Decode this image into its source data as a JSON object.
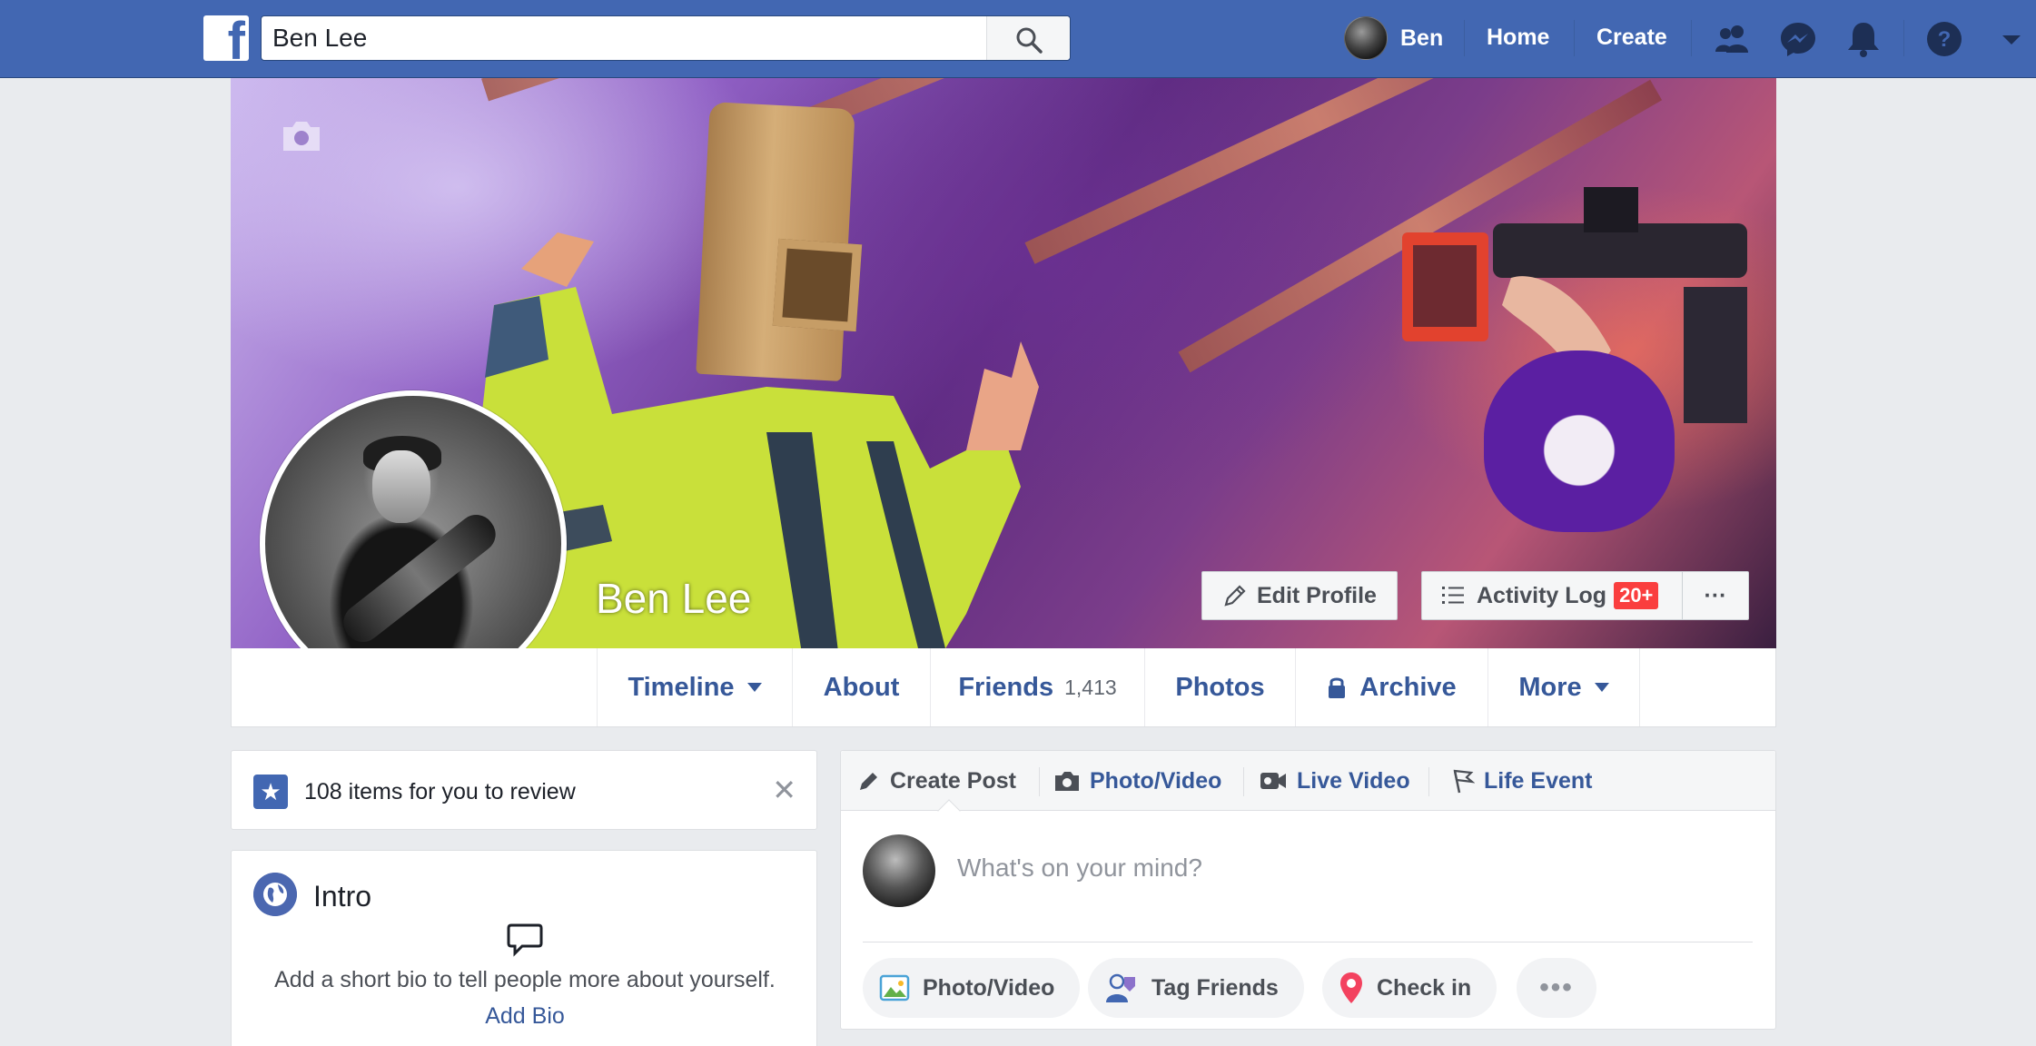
{
  "topbar": {
    "logo_letter": "f",
    "search_value": "Ben Lee",
    "user_name": "Ben",
    "home_label": "Home",
    "create_label": "Create",
    "icons": [
      "friend-requests-icon",
      "messenger-icon",
      "notifications-icon",
      "help-icon",
      "account-menu-icon"
    ]
  },
  "profile": {
    "name": "Ben Lee",
    "edit_label": "Edit Profile",
    "activity_label": "Activity Log",
    "activity_badge": "20+",
    "more_dots": "···"
  },
  "tabs": {
    "timeline": "Timeline",
    "about": "About",
    "friends": "Friends",
    "friends_count": "1,413",
    "photos": "Photos",
    "archive": "Archive",
    "more": "More"
  },
  "review": {
    "text": "108 items for you to review",
    "close": "✕"
  },
  "intro": {
    "title": "Intro",
    "description": "Add a short bio to tell people more about yourself.",
    "add_bio": "Add Bio"
  },
  "composer": {
    "create_post": "Create Post",
    "photo_video": "Photo/Video",
    "live_video": "Live Video",
    "life_event": "Life Event",
    "placeholder": "What's on your mind?",
    "pill_photo_video": "Photo/Video",
    "pill_tag_friends": "Tag Friends",
    "pill_check_in": "Check in",
    "pill_more": "•••"
  },
  "colors": {
    "brand_blue": "#4267b2",
    "link_blue": "#365899",
    "badge_red": "#fa3e3e",
    "page_bg": "#e9ebee"
  }
}
